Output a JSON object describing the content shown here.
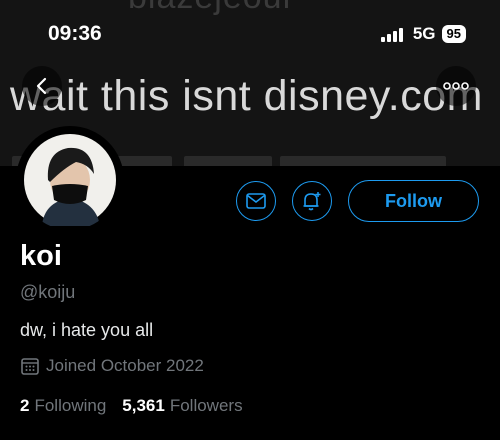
{
  "status_bar": {
    "time": "09:36",
    "network": "5G",
    "battery": "95"
  },
  "banner": {
    "top_text": "blazejeour",
    "main_text": "wait this isnt disney.com"
  },
  "profile": {
    "name": "koi",
    "handle": "@koiju",
    "bio": "dw, i hate you all",
    "joined": "Joined October 2022",
    "following_count": "2",
    "following_label": "Following",
    "followers_count": "5,361",
    "followers_label": "Followers"
  },
  "actions": {
    "follow_label": "Follow"
  },
  "colors": {
    "accent": "#1d9bf0",
    "muted": "#71767b",
    "background": "#000000"
  },
  "icons": [
    "back-arrow-icon",
    "more-icon",
    "message-icon",
    "notification-bell-icon",
    "calendar-icon"
  ]
}
